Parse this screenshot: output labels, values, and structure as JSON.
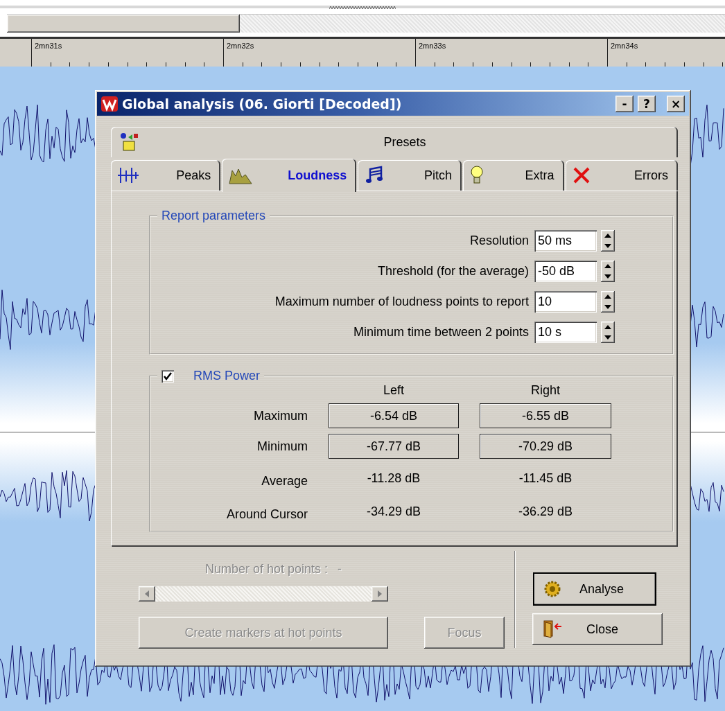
{
  "ruler": {
    "labels": [
      "2mn31s",
      "2mn32s",
      "2mn33s",
      "2mn34s"
    ]
  },
  "dialog": {
    "title": "Global analysis (06. Giorti [Decoded])",
    "title_buttons": [
      "-",
      "?",
      "×"
    ]
  },
  "presets_tab": {
    "label": "Presets"
  },
  "tabs": [
    {
      "label": "Peaks",
      "selected": false
    },
    {
      "label": "Loudness",
      "selected": true
    },
    {
      "label": "Pitch",
      "selected": false
    },
    {
      "label": "Extra",
      "selected": false
    },
    {
      "label": "Errors",
      "selected": false
    }
  ],
  "report_parameters": {
    "legend": "Report parameters",
    "fields": [
      {
        "label": "Resolution",
        "value": "50 ms"
      },
      {
        "label": "Threshold (for the average)",
        "value": "-50 dB"
      },
      {
        "label": "Maximum number of loudness points to report",
        "value": "10"
      },
      {
        "label": "Minimum time between 2 points",
        "value": "10 s"
      }
    ]
  },
  "rms_power": {
    "legend": "RMS Power",
    "checked": true,
    "columns": [
      "Left",
      "Right"
    ],
    "rows": [
      {
        "label": "Maximum",
        "kind": "boxed",
        "left": "-6.54 dB",
        "right": "-6.55 dB"
      },
      {
        "label": "Minimum",
        "kind": "boxed",
        "left": "-67.77 dB",
        "right": "-70.29 dB"
      },
      {
        "label": "Average",
        "kind": "plain",
        "left": "-11.28 dB",
        "right": "-11.45 dB"
      },
      {
        "label": "Around Cursor",
        "kind": "plain",
        "left": "-34.29 dB",
        "right": "-36.29 dB"
      }
    ]
  },
  "hot_points": {
    "label": "Number of hot points :",
    "value": "-",
    "disabled": true
  },
  "hot_buttons": [
    {
      "label": "Create markers at hot points",
      "disabled": true
    },
    {
      "label": "Focus",
      "disabled": true
    }
  ],
  "actions": [
    {
      "label": "Analyse",
      "kind": "analyse",
      "focused": true
    },
    {
      "label": "Close",
      "kind": "close",
      "focused": false
    }
  ]
}
